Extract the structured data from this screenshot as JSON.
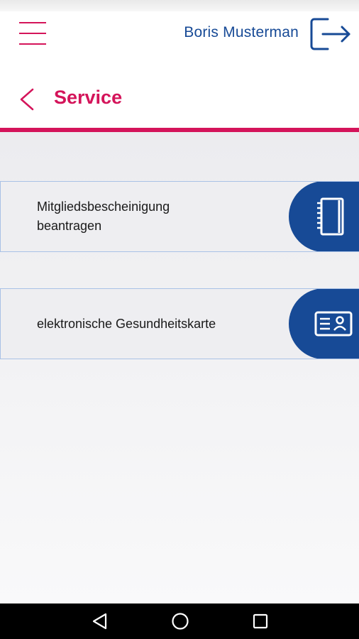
{
  "header": {
    "user_name": "Boris Musterman",
    "icons": {
      "menu": "hamburger-menu-icon",
      "logout": "logout-icon"
    }
  },
  "page": {
    "title": "Service",
    "back_icon": "chevron-left-icon"
  },
  "services": [
    {
      "label_line1": "Mitgliedsbescheinigung",
      "label_line2": "beantragen",
      "icon": "notebook-icon"
    },
    {
      "label_line1": "elektronische Gesundheitskarte",
      "label_line2": "",
      "icon": "id-card-icon"
    }
  ],
  "android_nav": {
    "icons": [
      "back-triangle-icon",
      "home-circle-icon",
      "recents-square-icon"
    ]
  },
  "colors": {
    "accent": "#d4145a",
    "brand_blue": "#174a96",
    "card_border": "#a9c1e6",
    "card_bg": "#eeeef1"
  }
}
